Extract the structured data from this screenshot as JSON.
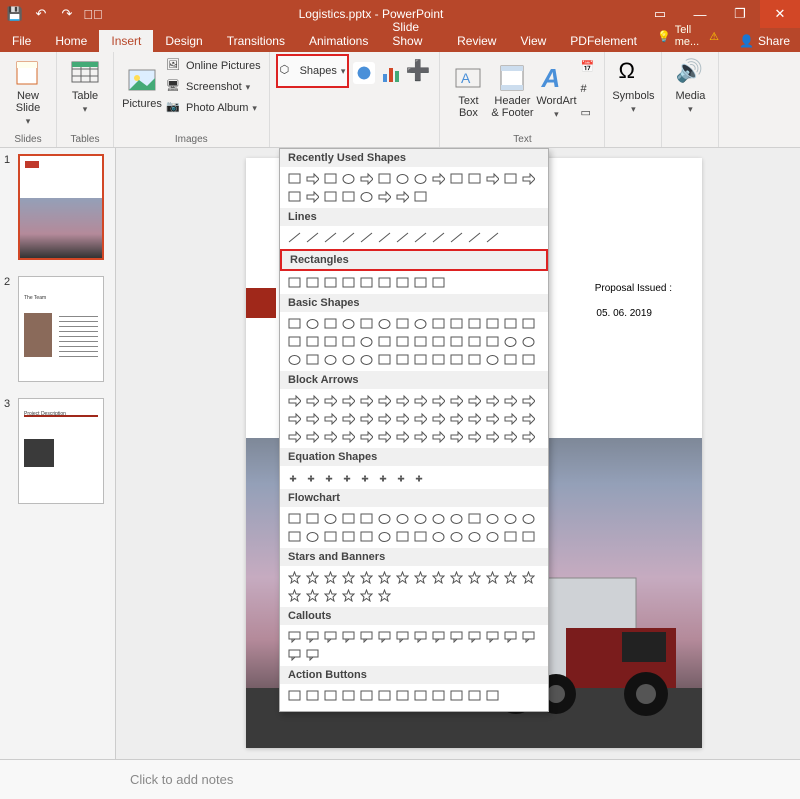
{
  "title": "Logistics.pptx - PowerPoint",
  "qat": {
    "save": "💾",
    "undo": "↶",
    "redo": "↷",
    "start": "▷⃞"
  },
  "win": {
    "ribbon_opts": "▭",
    "min": "—",
    "restore": "❐",
    "close": "✕"
  },
  "tabs": {
    "file": "File",
    "home": "Home",
    "insert": "Insert",
    "design": "Design",
    "transitions": "Transitions",
    "animations": "Animations",
    "slideshow": "Slide Show",
    "review": "Review",
    "view": "View",
    "pdfelement": "PDFelement"
  },
  "tellme": "Tell me...",
  "share": "Share",
  "ribbon": {
    "new_slide": "New\nSlide",
    "slides_grp": "Slides",
    "table": "Table",
    "tables_grp": "Tables",
    "pictures": "Pictures",
    "online_pics": "Online Pictures",
    "screenshot": "Screenshot",
    "photo_album": "Photo Album",
    "images_grp": "Images",
    "shapes": "Shapes",
    "text_box": "Text\nBox",
    "header_footer": "Header\n& Footer",
    "wordart": "WordArt",
    "text_grp": "Text",
    "symbols": "Symbols",
    "media": "Media"
  },
  "thumbs": [
    {
      "n": "1",
      "sel": true
    },
    {
      "n": "2",
      "sel": false
    },
    {
      "n": "3",
      "sel": false
    }
  ],
  "slide": {
    "proposal_label": "Proposal Issued :",
    "proposal_date": "05. 06. 2019"
  },
  "shapes_dd": {
    "recently": "Recently Used Shapes",
    "lines": "Lines",
    "rectangles": "Rectangles",
    "basic": "Basic Shapes",
    "block": "Block Arrows",
    "equation": "Equation Shapes",
    "flow": "Flowchart",
    "stars": "Stars and Banners",
    "call": "Callouts",
    "action": "Action Buttons"
  },
  "notes_placeholder": "Click to add notes"
}
